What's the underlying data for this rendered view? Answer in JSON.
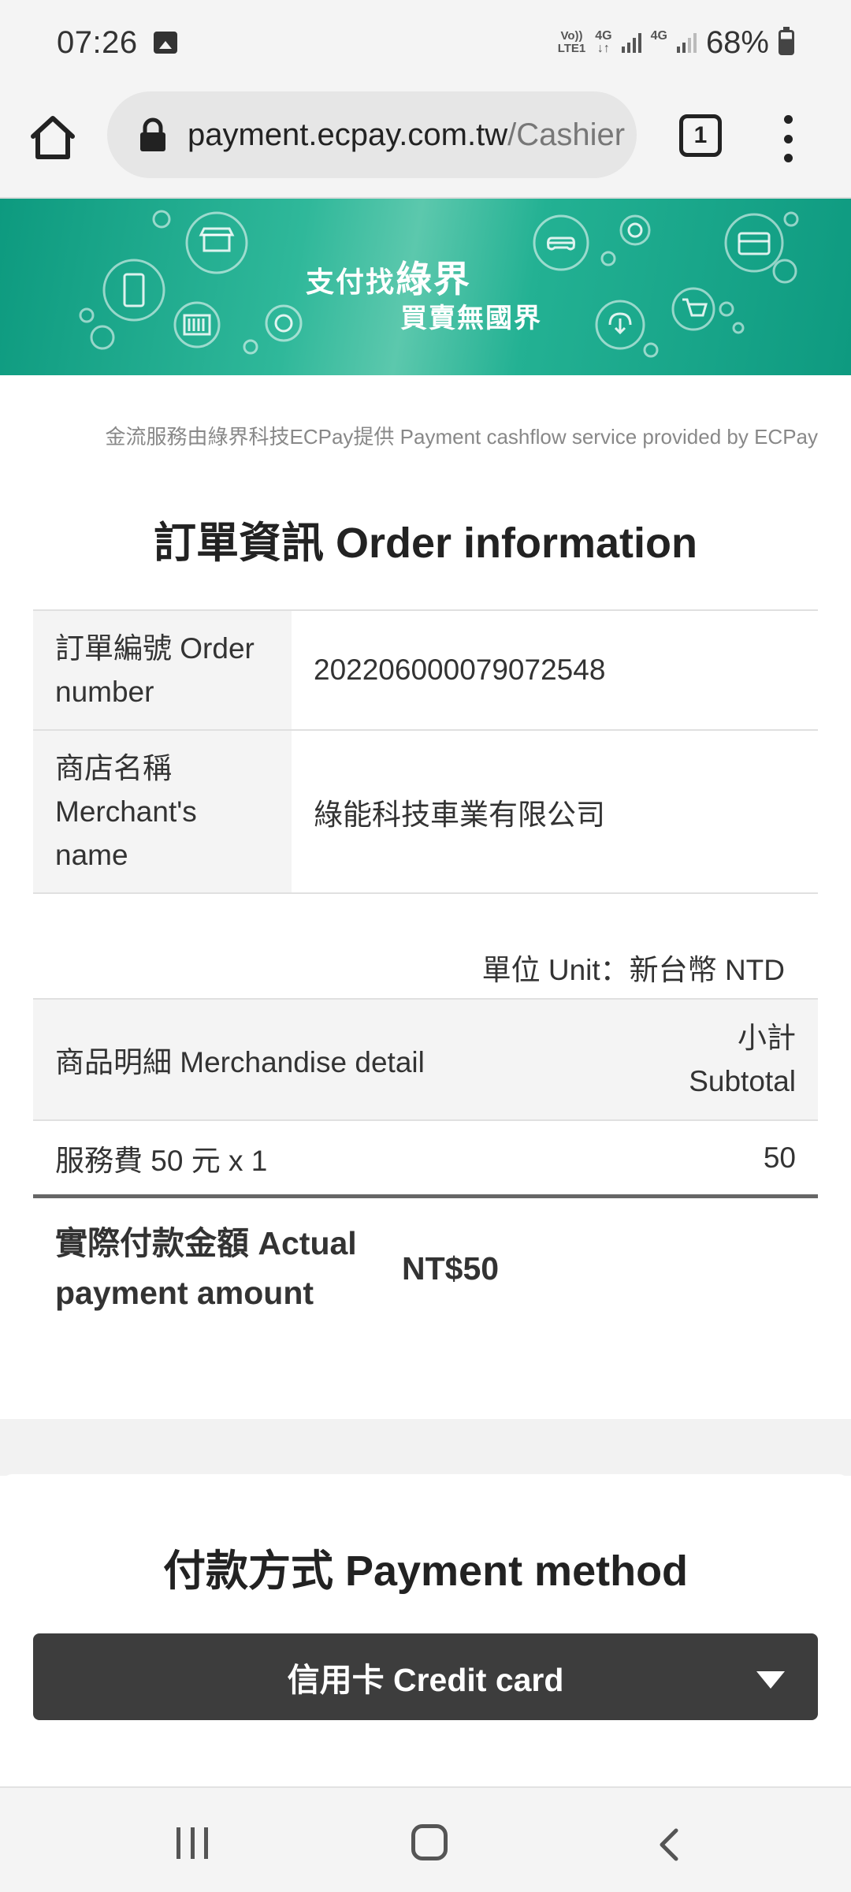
{
  "status_bar": {
    "time": "07:26",
    "volte_top": "Vo))",
    "volte_bottom": "LTE1",
    "net1": "4G",
    "net1_arrows": "↓↑",
    "net2": "4G",
    "battery": "68%"
  },
  "browser": {
    "url_domain": "payment.ecpay.com.tw",
    "url_path": "/Cashier",
    "tab_count": "1"
  },
  "banner": {
    "line1_prefix": "支付找",
    "line1_brand": "綠界",
    "line2": "買賣無國界"
  },
  "provider_text": "金流服務由綠界科技ECPay提供 Payment cashflow service provided by ECPay",
  "order_section": {
    "title": "訂單資訊 Order information",
    "rows": [
      {
        "label": "訂單編號 Order number",
        "value": "2022060000790725​48"
      },
      {
        "label": "商店名稱 Merchant's name",
        "value": "綠能科技車業有限公司"
      }
    ]
  },
  "unit_note": "單位 Unit：新台幣 NTD",
  "detail": {
    "header_item": "商品明細 Merchandise detail",
    "header_subtotal": "小計 Subtotal",
    "items": [
      {
        "name": "服務費 50 元 x 1",
        "subtotal": "50"
      }
    ],
    "total_label": "實際付款金額 Actual payment amount",
    "total_value": "NT$50"
  },
  "payment": {
    "title": "付款方式 Payment method",
    "selected_method": "信用卡 Credit card"
  }
}
